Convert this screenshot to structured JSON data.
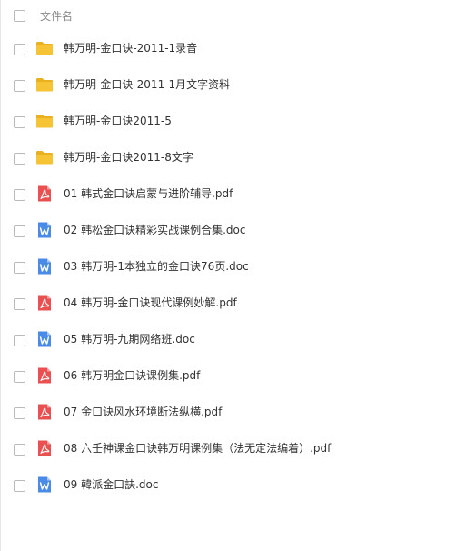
{
  "header": {
    "column_label": "文件名"
  },
  "colors": {
    "folder": "#F6C334",
    "folder_tab": "#E9B01F",
    "pdf": "#E9504F",
    "doc": "#4A8BE8"
  },
  "files": [
    {
      "name": "韩万明-金口诀-2011-1录音",
      "icon": "folder-icon"
    },
    {
      "name": "韩万明-金口诀-2011-1月文字资料",
      "icon": "folder-icon"
    },
    {
      "name": "韩万明-金口诀2011-5",
      "icon": "folder-icon"
    },
    {
      "name": "韩万明-金口诀2011-8文字",
      "icon": "folder-icon"
    },
    {
      "name": "01 韩式金口诀启蒙与进阶辅导.pdf",
      "icon": "pdf-icon"
    },
    {
      "name": "02 韩松金口诀精彩实战课例合集.doc",
      "icon": "word-doc-icon"
    },
    {
      "name": "03 韩万明-1本独立的金口诀76页.doc",
      "icon": "word-doc-icon"
    },
    {
      "name": "04 韩万明-金口诀现代课例妙解.pdf",
      "icon": "pdf-icon"
    },
    {
      "name": "05 韩万明-九期网络班.doc",
      "icon": "word-doc-icon"
    },
    {
      "name": "06 韩万明金口诀课例集.pdf",
      "icon": "pdf-icon"
    },
    {
      "name": "07 金口诀风水环境断法纵横.pdf",
      "icon": "pdf-icon"
    },
    {
      "name": "08 六壬神课金口诀韩万明课例集（法无定法编着）.pdf",
      "icon": "pdf-icon"
    },
    {
      "name": "09 韓派金口訣.doc",
      "icon": "word-doc-icon"
    }
  ]
}
